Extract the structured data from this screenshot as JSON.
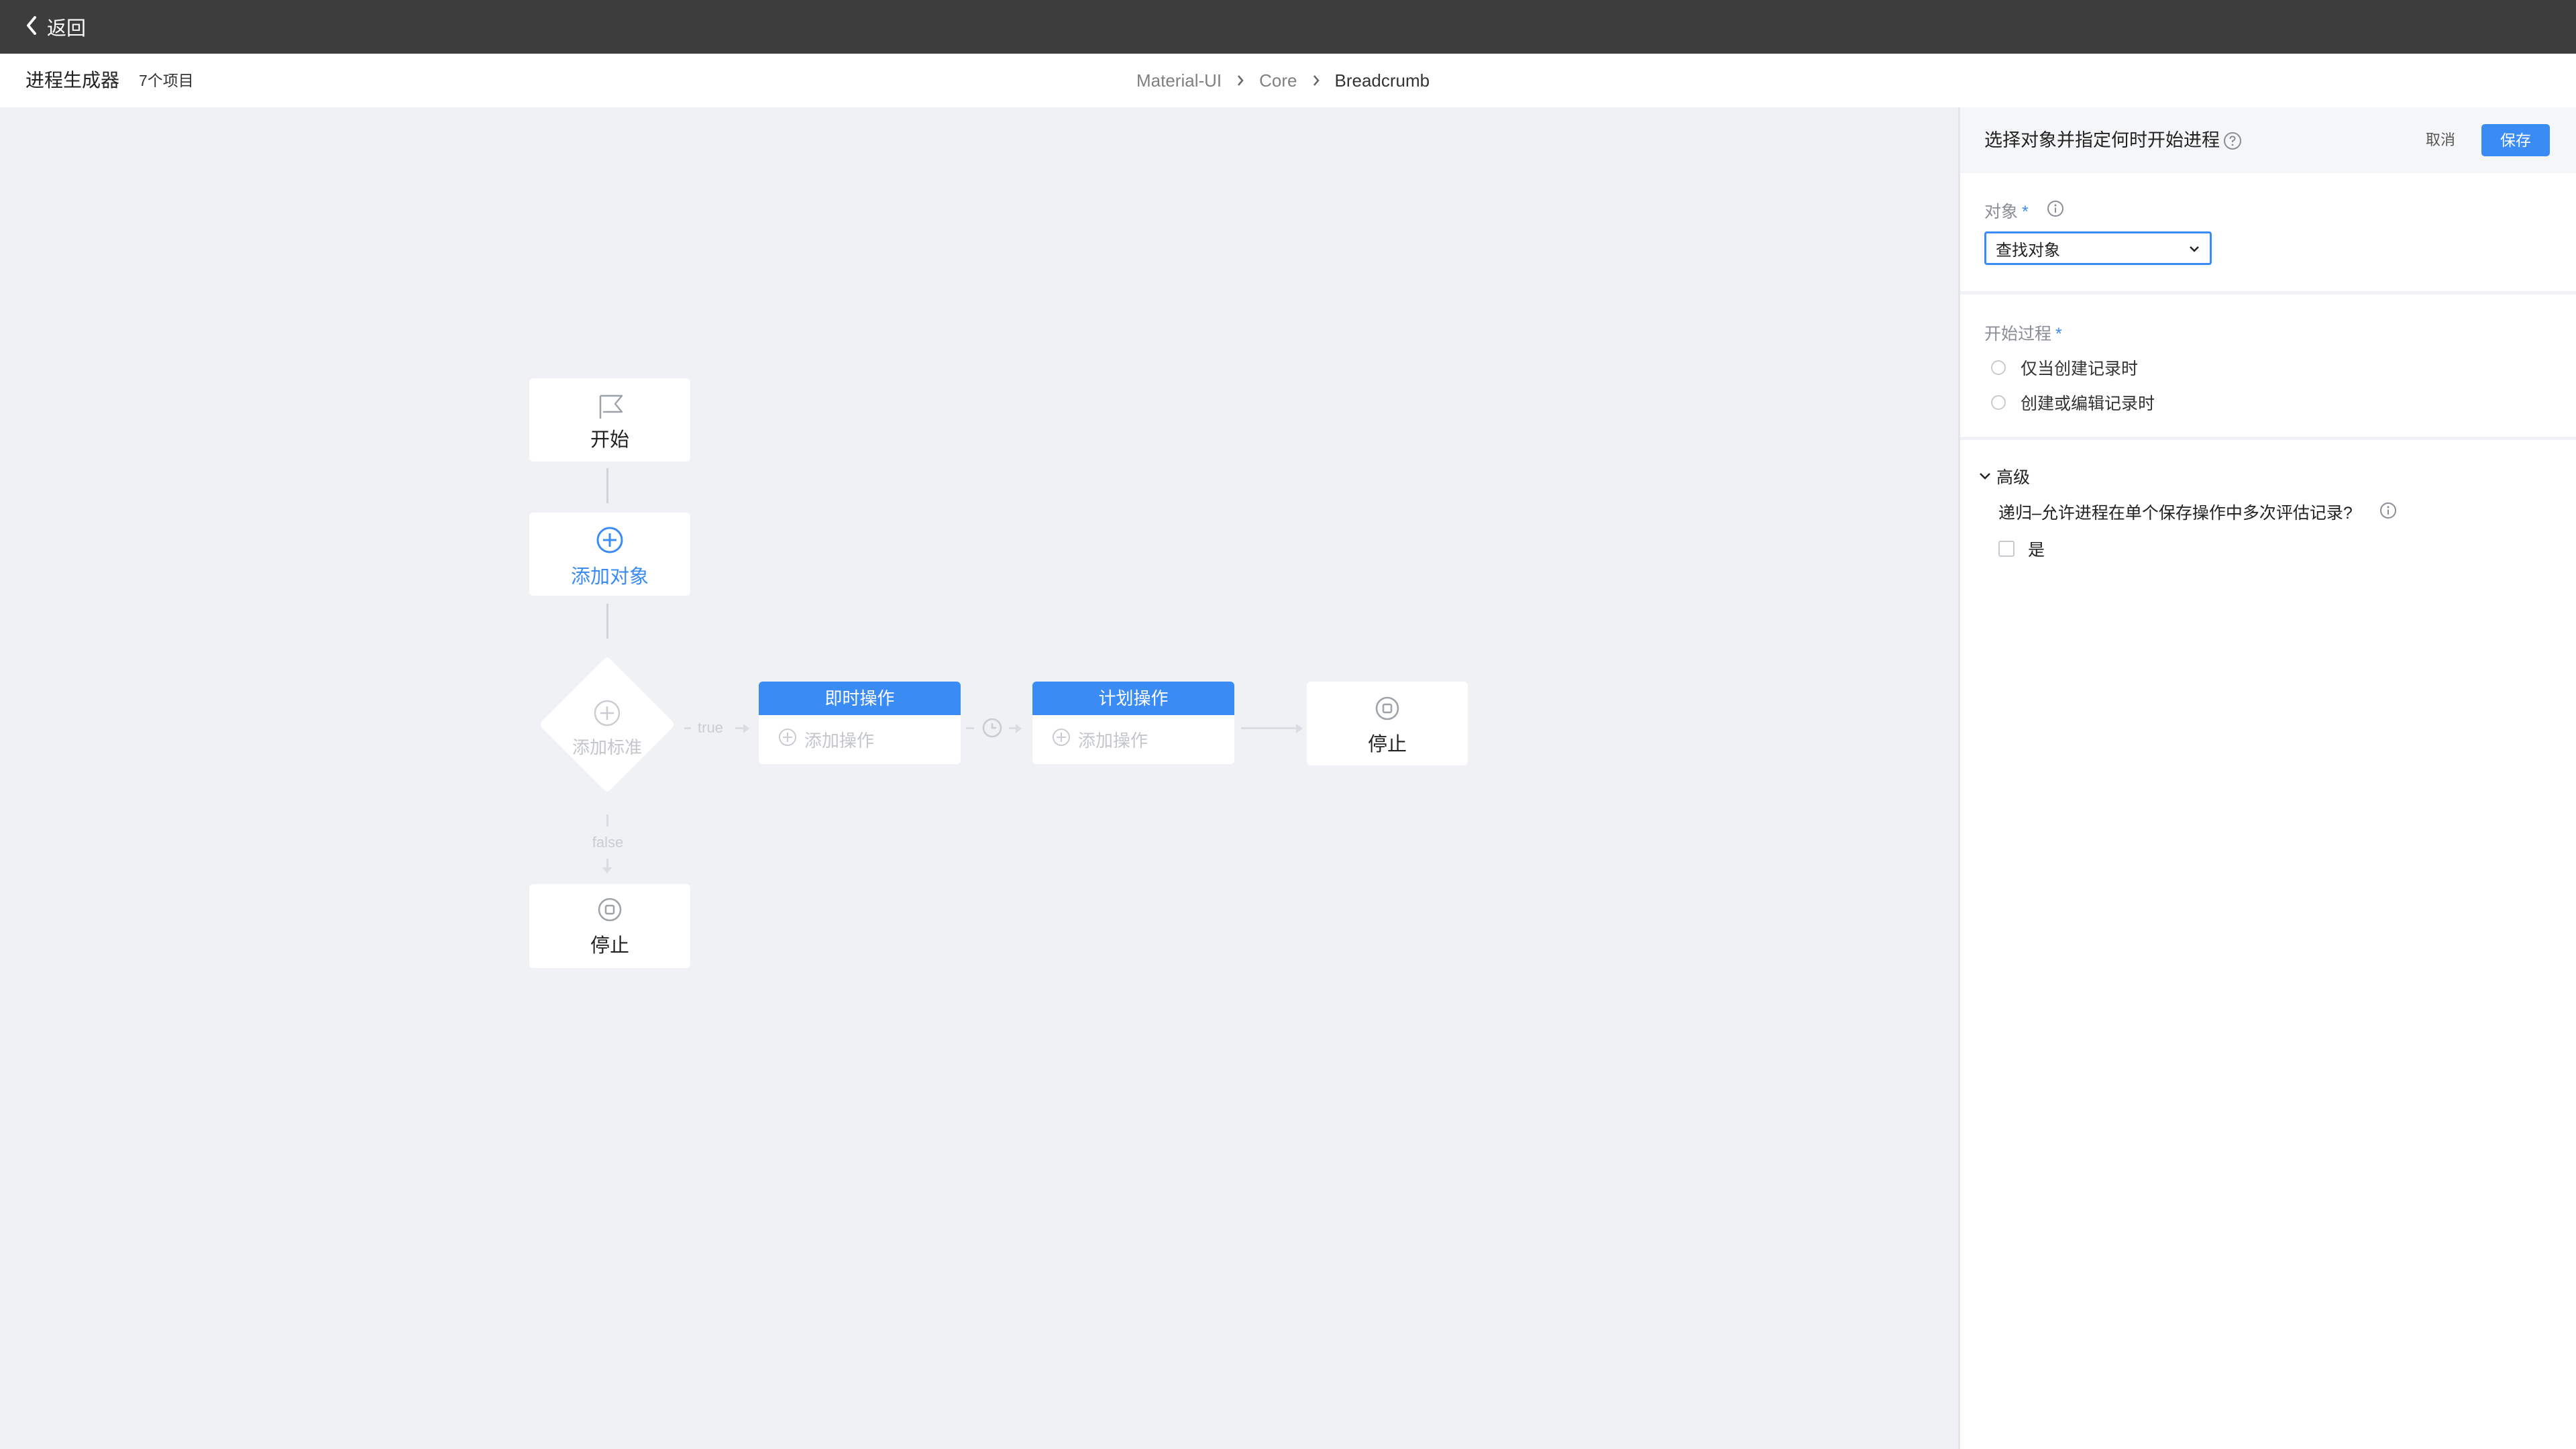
{
  "topbar": {
    "back_label": "返回"
  },
  "header": {
    "title": "进程生成器",
    "item_count": "7个项目",
    "breadcrumb": [
      "Material-UI",
      "Core",
      "Breadcrumb"
    ]
  },
  "flow": {
    "start_label": "开始",
    "add_object_label": "添加对象",
    "add_criteria_label": "添加标准",
    "true_label": "true",
    "false_label": "false",
    "immediate_action": {
      "title": "即时操作",
      "add_label": "添加操作"
    },
    "scheduled_action": {
      "title": "计划操作",
      "add_label": "添加操作"
    },
    "stop_label_right": "停止",
    "stop_label_bottom": "停止"
  },
  "panel": {
    "title": "选择对象并指定何时开始进程",
    "cancel_label": "取消",
    "save_label": "保存",
    "object_label": "对象",
    "required_mark": "*",
    "object_select_value": "查找对象",
    "start_process_label": "开始过程",
    "radio_options": [
      "仅当创建记录时",
      "创建或编辑记录时"
    ],
    "advanced_label": "高级",
    "recursion_question": "递归–允许进程在单个保存操作中多次评估记录?",
    "recursion_checkbox_label": "是"
  },
  "colors": {
    "accent": "#3b8bf5",
    "topbar": "#3d3d3d",
    "canvas": "#eff1f4"
  }
}
